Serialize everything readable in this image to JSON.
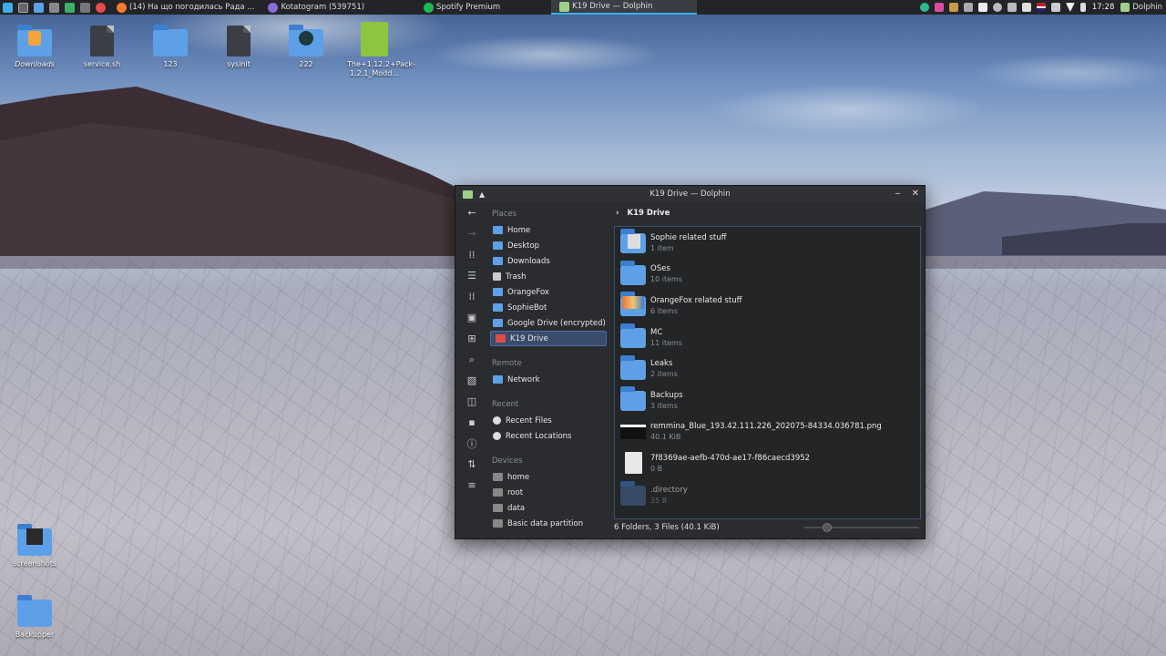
{
  "taskbar": {
    "tasks": [
      {
        "label": "(14) На що погодилась Рада ...",
        "icon": "firefox-icon"
      },
      {
        "label": "Kotatogram (539751)",
        "icon": "telegram-icon"
      },
      {
        "label": "Spotify Premium",
        "icon": "spotify-icon"
      },
      {
        "label": "K19 Drive — Dolphin",
        "icon": "dolphin-icon"
      }
    ],
    "clock": "17:28",
    "active_app": "Dolphin"
  },
  "desktop": {
    "icons": [
      {
        "label": "Downloads",
        "kind": "folder-special"
      },
      {
        "label": "service.sh",
        "kind": "file"
      },
      {
        "label": "123",
        "kind": "folder"
      },
      {
        "label": "sysinit",
        "kind": "file"
      },
      {
        "label": "222",
        "kind": "folder-special"
      },
      {
        "label": "The+1.12.2+Pack-1.2.1_Modd...",
        "kind": "archive"
      },
      {
        "label": "screenshots",
        "kind": "folder-special"
      },
      {
        "label": "Backupper",
        "kind": "folder"
      }
    ]
  },
  "window": {
    "title": "K19 Drive — Dolphin",
    "breadcrumb": "K19 Drive",
    "places": {
      "places_header": "Places",
      "items": [
        "Home",
        "Desktop",
        "Downloads",
        "Trash",
        "OrangeFox",
        "SophieBot",
        "Google Drive (encrypted)",
        "K19 Drive"
      ],
      "remote_header": "Remote",
      "remote": [
        "Network"
      ],
      "recent_header": "Recent",
      "recent": [
        "Recent Files",
        "Recent Locations"
      ],
      "devices_header": "Devices",
      "devices": [
        "home",
        "root",
        "data",
        "Basic data partition"
      ]
    },
    "files": [
      {
        "name": "Sophie related stuff",
        "size": "1 item",
        "type": "folder-thumb"
      },
      {
        "name": "OSes",
        "size": "10 items",
        "type": "folder"
      },
      {
        "name": "OrangeFox related stuff",
        "size": "6 items",
        "type": "folder-thumb"
      },
      {
        "name": "MC",
        "size": "11 items",
        "type": "folder"
      },
      {
        "name": "Leaks",
        "size": "2 items",
        "type": "folder"
      },
      {
        "name": "Backups",
        "size": "3 items",
        "type": "folder"
      },
      {
        "name": "remmina_Blue_193.42.111.226_202075-84334.036781.png",
        "size": "40.1 KiB",
        "type": "image"
      },
      {
        "name": "7f8369ae-aefb-470d-ae17-f86caecd3952",
        "size": "0 B",
        "type": "file"
      },
      {
        "name": ".directory",
        "size": "35 B",
        "type": "hidden"
      }
    ],
    "status": "6 Folders, 3 Files (40.1 KiB)",
    "zoom_level": 0.2
  },
  "colors": {
    "accent": "#3daee9",
    "folder": "#5ea0e8"
  }
}
